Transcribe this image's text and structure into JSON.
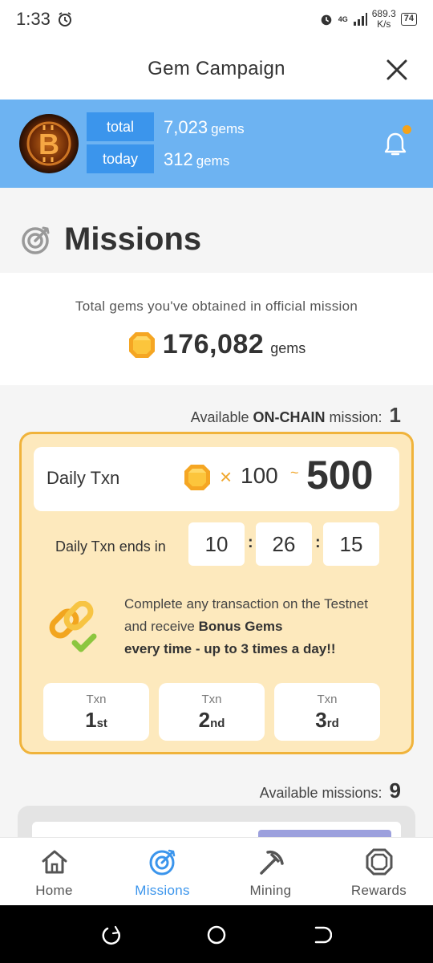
{
  "status_bar": {
    "time": "1:33",
    "network": "4G",
    "speed_value": "689.3",
    "speed_unit": "K/s",
    "battery": "74"
  },
  "header": {
    "title": "Gem Campaign"
  },
  "banner": {
    "total_label": "total",
    "total_value": "7,023",
    "today_label": "today",
    "today_value": "312",
    "unit": "gems"
  },
  "missions": {
    "title": "Missions",
    "obtained_caption": "Total gems you've obtained in official mission",
    "obtained_value": "176,082",
    "obtained_unit": "gems"
  },
  "onchain": {
    "prefix": "Available ",
    "bold": "ON-CHAIN",
    "suffix": " mission: ",
    "count": "1"
  },
  "daily_txn": {
    "label": "Daily Txn",
    "times": "×",
    "min": "100",
    "tilde": "~",
    "max": "500",
    "ends_label": "Daily Txn ends in",
    "hours": "10",
    "minutes": "26",
    "seconds": "15",
    "colon": ":",
    "desc_plain": "Complete any transaction on the Testnet and receive ",
    "desc_bold1": "Bonus Gems",
    "desc_bold2": "every time - up to 3 times a day!!",
    "txn": [
      {
        "label": "Txn",
        "num": "1",
        "suffix": "st"
      },
      {
        "label": "Txn",
        "num": "2",
        "suffix": "nd"
      },
      {
        "label": "Txn",
        "num": "3",
        "suffix": "rd"
      }
    ]
  },
  "available_missions": {
    "label": "Available missions: ",
    "count": "9"
  },
  "tabs": [
    {
      "label": "Home",
      "icon": "home-icon"
    },
    {
      "label": "Missions",
      "icon": "target-icon",
      "active": true
    },
    {
      "label": "Mining",
      "icon": "pickaxe-icon"
    },
    {
      "label": "Rewards",
      "icon": "gem-outline-icon"
    }
  ],
  "colors": {
    "banner_blue": "#6db3f2",
    "pill_blue": "#3b95ec",
    "card_bg": "#fde9bd",
    "card_border": "#f0b33b",
    "gem_gold": "#f5a623"
  }
}
